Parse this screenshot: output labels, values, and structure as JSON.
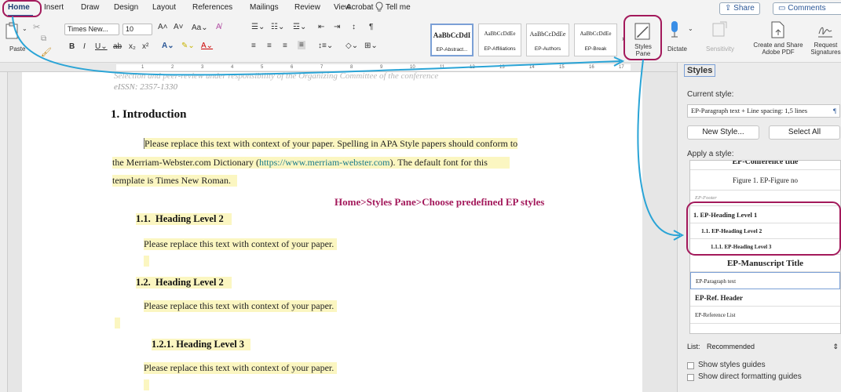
{
  "tabs": [
    {
      "label": "Home",
      "active": true
    },
    {
      "label": "Insert"
    },
    {
      "label": "Draw"
    },
    {
      "label": "Design"
    },
    {
      "label": "Layout"
    },
    {
      "label": "References"
    },
    {
      "label": "Mailings"
    },
    {
      "label": "Review"
    },
    {
      "label": "View"
    },
    {
      "label": "Acrobat"
    },
    {
      "label": "Tell me"
    }
  ],
  "share_label": "Share",
  "comments_label": "Comments",
  "ribbon": {
    "paste_label": "Paste",
    "font_name": "Times New...",
    "font_size": "10",
    "style_gallery": [
      {
        "sample": "AaBbCcDdI",
        "name": "EP-Abstract..."
      },
      {
        "sample": "AaBbCcDdEe",
        "name": "EP-Affiliations"
      },
      {
        "sample": "AaBbCcDdEe",
        "name": "EP-Authors"
      },
      {
        "sample": "AaBbCcDdEe",
        "name": "EP-Break"
      }
    ],
    "styles_pane_label": "Styles Pane",
    "dictate_label": "Dictate",
    "sensitivity_label": "Sensitivity",
    "create_share_label": "Create and Share Adobe PDF",
    "request_sig_label": "Request Signatures"
  },
  "ruler_ticks": [
    "1",
    "2",
    "3",
    "4",
    "5",
    "6",
    "7",
    "8",
    "9",
    "10",
    "11",
    "12",
    "13",
    "14",
    "15",
    "16",
    "17"
  ],
  "document": {
    "header_note_1": "Selection and peer-review under responsibility of the Organizing Committee of the conference",
    "header_note_2": "eISSN: 2357-1330",
    "h1": "1.   Introduction",
    "para1_line1": "Please replace this text with context of your paper. Spelling in APA Style papers should conform to",
    "para1_line2_pre": "the Merriam-Webster.com Dictionary (",
    "para1_link": "https://www.merriam-webster.com",
    "para1_line2_post": "). The default font for this",
    "para1_line3": "template is Times New Roman.",
    "annotation": "Home>Styles Pane>Choose predefined EP styles",
    "h2a_num": "1.1.",
    "h2a_text": "Heading Level 2",
    "body_a": "Please replace this text with context of your paper.",
    "h2b_num": "1.2.",
    "h2b_text": "Heading Level 2",
    "body_b": "Please replace this text with context of your paper.",
    "h3_num": "1.2.1.",
    "h3_text": "Heading Level 3",
    "body_c": "Please replace this text with context of your paper."
  },
  "styles_pane": {
    "title": "Styles",
    "current_style_label": "Current style:",
    "current_style_value": "EP-Paragraph text + Line spacing:  1,5 lines",
    "new_style_label": "New Style...",
    "select_all_label": "Select All",
    "apply_label": "Apply a style:",
    "styles": [
      {
        "name": "EP-Conference title"
      },
      {
        "name": "Figure 1.  EP-Figure no"
      },
      {
        "name": "EP-Footer"
      },
      {
        "name": "1.  EP-Heading Level 1"
      },
      {
        "name": "1.1.  EP-Heading Level 2"
      },
      {
        "name": "1.1.1.  EP-Heading Level 3"
      },
      {
        "name": "EP-Manuscript Title"
      },
      {
        "name": "EP-Paragraph text"
      },
      {
        "name": "EP-Ref. Header"
      },
      {
        "name": "EP-Reference List"
      }
    ],
    "list_label": "List:",
    "list_value": "Recommended",
    "show_guides_label": "Show styles guides",
    "show_direct_label": "Show direct formatting guides"
  },
  "colors": {
    "highlight_ring": "#a3195b",
    "arrow": "#2aa4d6",
    "annotation_text": "#a3195b",
    "text_highlight": "#fbf6c1"
  }
}
